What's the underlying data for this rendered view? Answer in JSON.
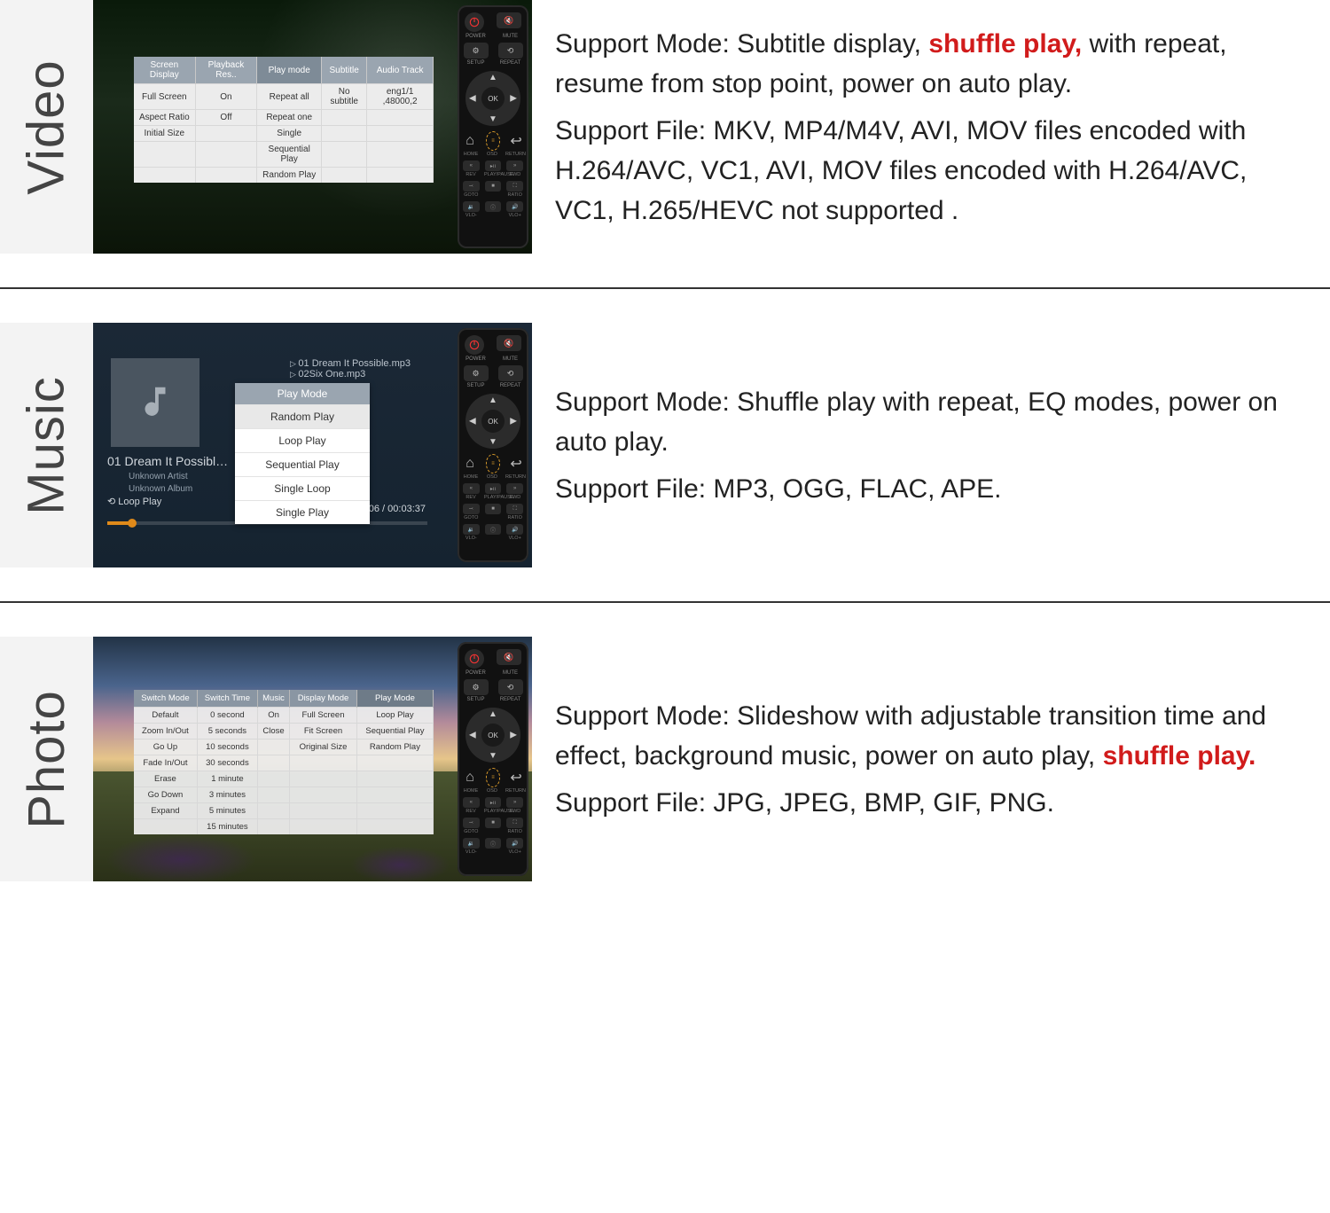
{
  "sections": {
    "video": {
      "label": "Video",
      "desc1a": "Support Mode: Subtitle display, ",
      "desc1_red": "shuffle play,",
      "desc1b": " with repeat, resume from stop point, power on auto play.",
      "desc2": "Support File: MKV, MP4/M4V, AVI, MOV files encoded with H.264/AVC, VC1, AVI, MOV files encoded with H.264/AVC, VC1, H.265/HEVC not supported .",
      "menu": {
        "headers": [
          "Screen Display",
          "Playback Res..",
          "Play mode",
          "Subtitle",
          "Audio Track"
        ],
        "cols": [
          [
            "Full Screen",
            "Aspect Ratio",
            "Initial Size"
          ],
          [
            "On",
            "Off"
          ],
          [
            "Repeat all",
            "Repeat one",
            "Single",
            "Sequential Play",
            "Random Play"
          ],
          [
            "No subtitle"
          ],
          [
            "eng1/1 ,48000,2"
          ]
        ]
      }
    },
    "music": {
      "label": "Music",
      "desc1": "Support Mode: Shuffle play with repeat, EQ modes, power on auto play.",
      "desc2": "Support File: MP3, OGG, FLAC, APE.",
      "nowplaying": {
        "title": "01 Dream It Possible...",
        "artist": "Unknown Artist",
        "album": "Unknown Album",
        "loop": "Loop Play",
        "position": "00:00:06",
        "duration": "00:03:37",
        "files": [
          "01 Dream It Possible.mp3",
          "02Six One.mp3"
        ],
        "menu_title": "Play Mode",
        "options": [
          "Random Play",
          "Loop Play",
          "Sequential Play",
          "Single Loop",
          "Single Play"
        ]
      }
    },
    "photo": {
      "label": "Photo",
      "desc1a": "Support Mode: Slideshow with adjustable transition time and effect, background music, power on auto play, ",
      "desc1_red": "shuffle play.",
      "desc2": "Support File: JPG, JPEG, BMP, GIF, PNG.",
      "menu": {
        "headers": [
          "Switch Mode",
          "Switch Time",
          "Music",
          "Display Mode",
          "Play Mode"
        ],
        "cols": [
          [
            "Default",
            "Zoom In/Out",
            "Go Up",
            "Fade In/Out",
            "Erase",
            "Go Down",
            "Expand"
          ],
          [
            "0 second",
            "5 seconds",
            "10 seconds",
            "30 seconds",
            "1 minute",
            "3 minutes",
            "5 minutes",
            "15 minutes"
          ],
          [
            "On",
            "Close"
          ],
          [
            "Full Screen",
            "Fit Screen",
            "Original Size"
          ],
          [
            "Loop Play",
            "Sequential Play",
            "Random Play"
          ]
        ]
      }
    }
  },
  "remote": {
    "row1_lbls": [
      "POWER",
      "MUTE"
    ],
    "row2_lbls": [
      "SETUP",
      "REPEAT"
    ],
    "ok": "OK",
    "osd": "OSD",
    "navrow_lbls": [
      "HOME",
      "OSD",
      "RETURN"
    ],
    "media_lbls": [
      "REV",
      "PLAY/PAUSE",
      "FWD"
    ],
    "util_lbls": [
      "GOTO",
      "",
      "RATIO"
    ],
    "vol_lbls": [
      "VLO-",
      "",
      "VLO+"
    ]
  }
}
